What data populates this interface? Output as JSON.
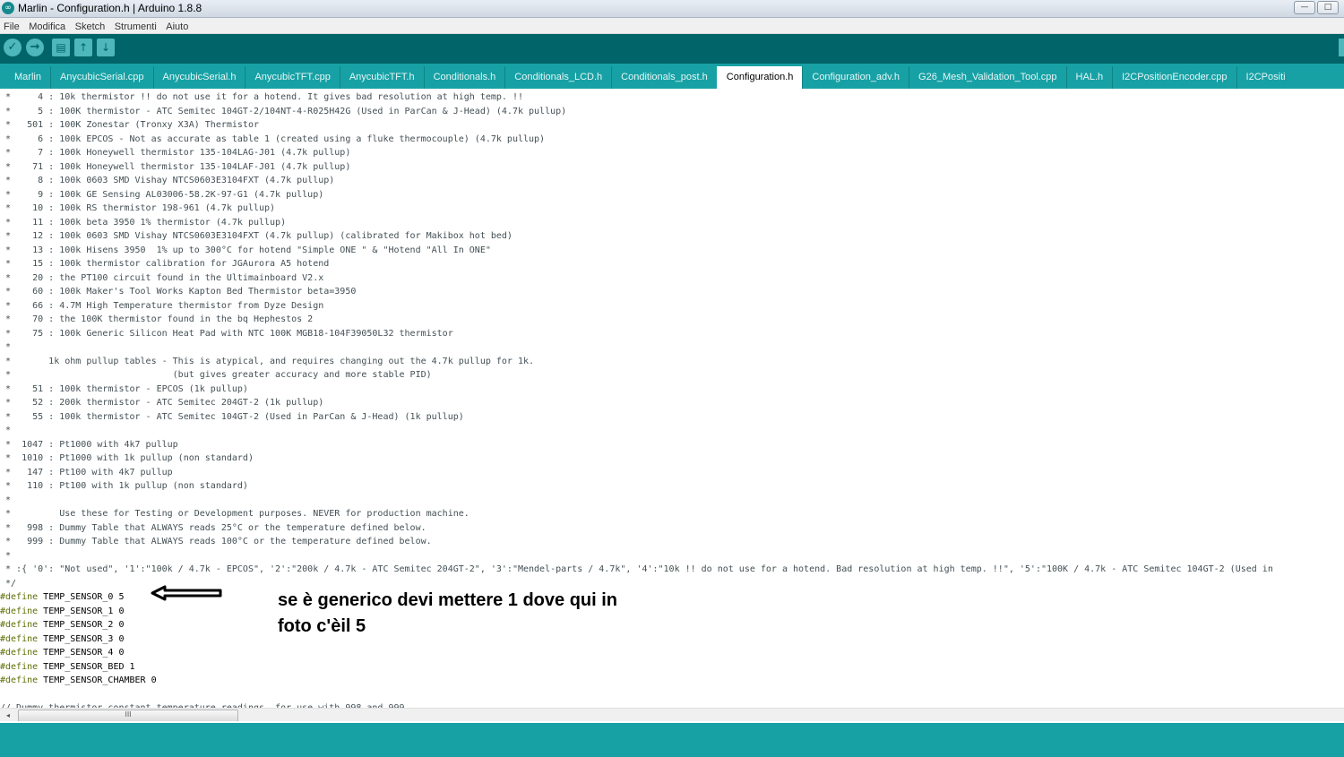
{
  "window": {
    "title": "Marlin - Configuration.h | Arduino 1.8.8",
    "logo_glyph": "∞",
    "buttons": [
      "—",
      "□",
      "✕"
    ]
  },
  "menu": {
    "items": [
      "File",
      "Modifica",
      "Sketch",
      "Strumenti",
      "Aiuto"
    ]
  },
  "toolbar": {
    "verify_icon": "✓",
    "upload_icon": "→",
    "new_icon": "▤",
    "open_icon": "↑",
    "save_icon": "↓"
  },
  "tabs": [
    "Marlin",
    "AnycubicSerial.cpp",
    "AnycubicSerial.h",
    "AnycubicTFT.cpp",
    "AnycubicTFT.h",
    "Conditionals.h",
    "Conditionals_LCD.h",
    "Conditionals_post.h",
    "Configuration.h",
    "Configuration_adv.h",
    "G26_Mesh_Validation_Tool.cpp",
    "HAL.h",
    "I2CPositionEncoder.cpp",
    "I2CPositi"
  ],
  "active_tab": "Configuration.h",
  "code_lines": [
    " *     4 : 10k thermistor !! do not use it for a hotend. It gives bad resolution at high temp. !!",
    " *     5 : 100K thermistor - ATC Semitec 104GT-2/104NT-4-R025H42G (Used in ParCan & J-Head) (4.7k pullup)",
    " *   501 : 100K Zonestar (Tronxy X3A) Thermistor",
    " *     6 : 100k EPCOS - Not as accurate as table 1 (created using a fluke thermocouple) (4.7k pullup)",
    " *     7 : 100k Honeywell thermistor 135-104LAG-J01 (4.7k pullup)",
    " *    71 : 100k Honeywell thermistor 135-104LAF-J01 (4.7k pullup)",
    " *     8 : 100k 0603 SMD Vishay NTCS0603E3104FXT (4.7k pullup)",
    " *     9 : 100k GE Sensing AL03006-58.2K-97-G1 (4.7k pullup)",
    " *    10 : 100k RS thermistor 198-961 (4.7k pullup)",
    " *    11 : 100k beta 3950 1% thermistor (4.7k pullup)",
    " *    12 : 100k 0603 SMD Vishay NTCS0603E3104FXT (4.7k pullup) (calibrated for Makibox hot bed)",
    " *    13 : 100k Hisens 3950  1% up to 300°C for hotend \"Simple ONE \" & \"Hotend \"All In ONE\"",
    " *    15 : 100k thermistor calibration for JGAurora A5 hotend",
    " *    20 : the PT100 circuit found in the Ultimainboard V2.x",
    " *    60 : 100k Maker's Tool Works Kapton Bed Thermistor beta=3950",
    " *    66 : 4.7M High Temperature thermistor from Dyze Design",
    " *    70 : the 100K thermistor found in the bq Hephestos 2",
    " *    75 : 100k Generic Silicon Heat Pad with NTC 100K MGB18-104F39050L32 thermistor",
    " *",
    " *       1k ohm pullup tables - This is atypical, and requires changing out the 4.7k pullup for 1k.",
    " *                              (but gives greater accuracy and more stable PID)",
    " *    51 : 100k thermistor - EPCOS (1k pullup)",
    " *    52 : 200k thermistor - ATC Semitec 204GT-2 (1k pullup)",
    " *    55 : 100k thermistor - ATC Semitec 104GT-2 (Used in ParCan & J-Head) (1k pullup)",
    " *",
    " *  1047 : Pt1000 with 4k7 pullup",
    " *  1010 : Pt1000 with 1k pullup (non standard)",
    " *   147 : Pt100 with 4k7 pullup",
    " *   110 : Pt100 with 1k pullup (non standard)",
    " *",
    " *         Use these for Testing or Development purposes. NEVER for production machine.",
    " *   998 : Dummy Table that ALWAYS reads 25°C or the temperature defined below.",
    " *   999 : Dummy Table that ALWAYS reads 100°C or the temperature defined below.",
    " *",
    " * :{ '0': \"Not used\", '1':\"100k / 4.7k - EPCOS\", '2':\"200k / 4.7k - ATC Semitec 204GT-2\", '3':\"Mendel-parts / 4.7k\", '4':\"10k !! do not use for a hotend. Bad resolution at high temp. !!\", '5':\"100K / 4.7k - ATC Semitec 104GT-2 (Used in",
    " */"
  ],
  "defines": [
    {
      "keyword": "#define",
      "rest": " TEMP_SENSOR_0 5"
    },
    {
      "keyword": "#define",
      "rest": " TEMP_SENSOR_1 0"
    },
    {
      "keyword": "#define",
      "rest": " TEMP_SENSOR_2 0"
    },
    {
      "keyword": "#define",
      "rest": " TEMP_SENSOR_3 0"
    },
    {
      "keyword": "#define",
      "rest": " TEMP_SENSOR_4 0"
    },
    {
      "keyword": "#define",
      "rest": " TEMP_SENSOR_BED 1"
    },
    {
      "keyword": "#define",
      "rest": " TEMP_SENSOR_CHAMBER 0"
    }
  ],
  "trailing_lines": [
    "",
    "// Dummy thermistor constant temperature readings, for use with 998 and 999"
  ],
  "annotation": {
    "line1": "se è generico devi mettere 1 dove  qui in",
    "line2": "foto c'èil 5"
  },
  "scrollbar": {
    "left_arrow": "◂",
    "thumb_grip": "III"
  },
  "colors": {
    "toolbar_bg": "#006468",
    "tabbar_bg": "#17a1a5",
    "define_keyword": "#5e6d03",
    "comment_text": "#434f54"
  }
}
